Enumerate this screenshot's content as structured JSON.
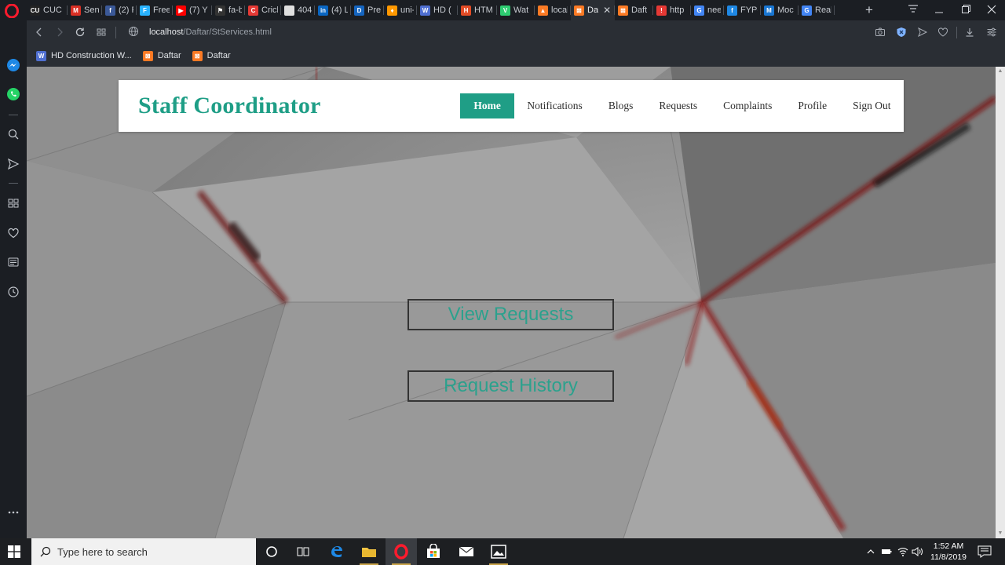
{
  "browser": {
    "tabs": [
      {
        "title": "CUC",
        "icon": "cuc-icon",
        "color": "#222222",
        "glyph": "CU"
      },
      {
        "title": "Sent",
        "icon": "gmail-icon",
        "color": "#d93025",
        "glyph": "M"
      },
      {
        "title": "(2) F",
        "icon": "facebook-icon",
        "color": "#3b5998",
        "glyph": "f"
      },
      {
        "title": "Free",
        "icon": "freelancer-icon",
        "color": "#29b2fe",
        "glyph": "F"
      },
      {
        "title": "(7) Y",
        "icon": "youtube-icon",
        "color": "#ff0000",
        "glyph": "▶"
      },
      {
        "title": "fa-b",
        "icon": "flag-icon",
        "color": "#333333",
        "glyph": "⚑"
      },
      {
        "title": "Crick",
        "icon": "cricket-icon",
        "color": "#e53935",
        "glyph": "C"
      },
      {
        "title": "404",
        "icon": "document-icon",
        "color": "#e0e0e0",
        "glyph": ""
      },
      {
        "title": "(4) L",
        "icon": "linkedin-icon",
        "color": "#0a66c2",
        "glyph": "in"
      },
      {
        "title": "Prep",
        "icon": "prep-icon",
        "color": "#1565c0",
        "glyph": "D"
      },
      {
        "title": "uni-",
        "icon": "flame-icon",
        "color": "#ff9800",
        "glyph": "♦"
      },
      {
        "title": "HD (",
        "icon": "hd-icon",
        "color": "#4f6fd1",
        "glyph": "W"
      },
      {
        "title": "HTM",
        "icon": "html-icon",
        "color": "#e34c26",
        "glyph": "H"
      },
      {
        "title": "Wat",
        "icon": "wattpad-icon",
        "color": "#2ecc71",
        "glyph": "V"
      },
      {
        "title": "local",
        "icon": "xampp-icon",
        "color": "#fb7a24",
        "glyph": "▲"
      },
      {
        "title": "Da",
        "icon": "xampp-icon",
        "color": "#fb7a24",
        "glyph": "⊠",
        "active": true
      },
      {
        "title": "Daft",
        "icon": "xampp-icon",
        "color": "#fb7a24",
        "glyph": "⊠"
      },
      {
        "title": "http",
        "icon": "opera-error-icon",
        "color": "#e53935",
        "glyph": "!"
      },
      {
        "title": "neec",
        "icon": "google-icon",
        "color": "#4285f4",
        "glyph": "G"
      },
      {
        "title": "FYP-",
        "icon": "f-icon",
        "color": "#1e88e5",
        "glyph": "f"
      },
      {
        "title": "Moc",
        "icon": "moqups-icon",
        "color": "#1976d2",
        "glyph": "M"
      },
      {
        "title": "Real",
        "icon": "google-icon",
        "color": "#4285f4",
        "glyph": "G"
      }
    ],
    "url_host": "localhost",
    "url_path": "/Daftar/StServices.html",
    "bookmarks": [
      {
        "label": "HD Construction W...",
        "icon": "hd-icon",
        "color": "#4f6fd1",
        "glyph": "W"
      },
      {
        "label": "Daftar",
        "icon": "xampp-icon",
        "color": "#fb7a24",
        "glyph": "⊠"
      },
      {
        "label": "Daftar",
        "icon": "xampp-icon",
        "color": "#fb7a24",
        "glyph": "⊠"
      }
    ]
  },
  "page": {
    "brand": "Staff Coordinator",
    "accent_color": "#1f9e86",
    "nav": [
      {
        "label": "Home",
        "active": true
      },
      {
        "label": "Notifications"
      },
      {
        "label": "Blogs"
      },
      {
        "label": "Requests"
      },
      {
        "label": "Complaints"
      },
      {
        "label": "Profile"
      },
      {
        "label": "Sign Out"
      }
    ],
    "actions": {
      "view_requests": "View Requests",
      "request_history": "Request History"
    }
  },
  "taskbar": {
    "search_placeholder": "Type here to search",
    "time": "1:52 AM",
    "date": "11/8/2019"
  }
}
